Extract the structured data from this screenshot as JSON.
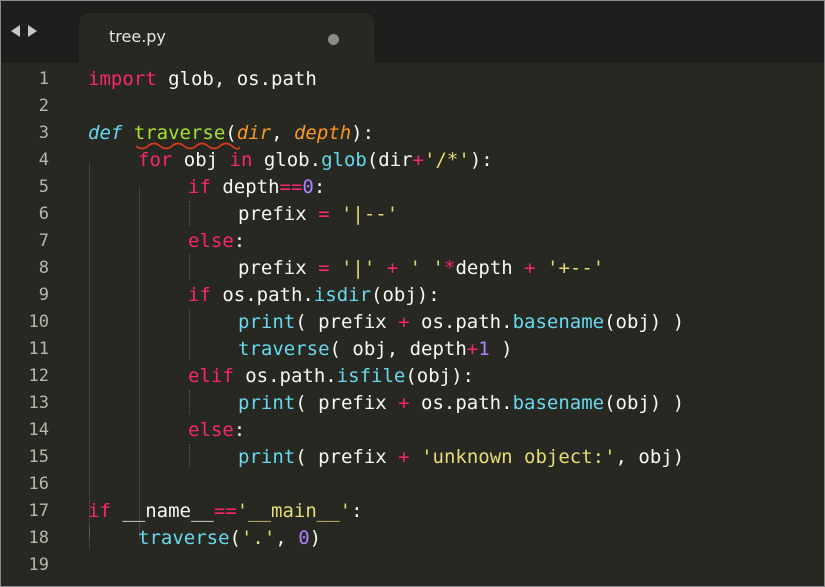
{
  "tab": {
    "title": "tree.py"
  },
  "line_numbers": [
    "1",
    "2",
    "3",
    "4",
    "5",
    "6",
    "7",
    "8",
    "9",
    "10",
    "11",
    "12",
    "13",
    "14",
    "15",
    "16",
    "17",
    "18",
    "19"
  ],
  "code": {
    "l1": {
      "import": "import",
      "rest": " glob, os.path"
    },
    "l3": {
      "def": "def",
      "sp": " ",
      "name": "traverse",
      "open": "(",
      "p1": "dir",
      "comma": ", ",
      "p2": "depth",
      "close": "):"
    },
    "l4": {
      "for": "for",
      "a": " obj ",
      "in": "in",
      "b": " glob.",
      "glob": "glob",
      "c": "(dir",
      "plus": "+",
      "s": "'/*'",
      "d": "):"
    },
    "l5": {
      "if": "if",
      "a": " depth",
      "eq": "==",
      "zero": "0",
      "b": ":"
    },
    "l6": {
      "a": "prefix ",
      "eq": "=",
      "sp": " ",
      "s": "'|--'"
    },
    "l7": {
      "else": "else",
      "b": ":"
    },
    "l8": {
      "a": "prefix ",
      "eq": "=",
      "sp": " ",
      "s1": "'|'",
      "sp2": " ",
      "p1": "+",
      "sp3": " ",
      "s2": "' '",
      "mul": "*",
      "b": "depth ",
      "p2": "+",
      "sp4": " ",
      "s3": "'+--'"
    },
    "l9": {
      "if": "if",
      "a": " os.path.",
      "fn": "isdir",
      "b": "(obj):"
    },
    "l10": {
      "print": "print",
      "a": "( prefix ",
      "plus": "+",
      "b": " os.path.",
      "fn": "basename",
      "c": "(obj) )"
    },
    "l11": {
      "fn": "traverse",
      "a": "( obj, depth",
      "plus": "+",
      "one": "1",
      "b": " )"
    },
    "l12": {
      "elif": "elif",
      "a": " os.path.",
      "fn": "isfile",
      "b": "(obj):"
    },
    "l13": {
      "print": "print",
      "a": "( prefix ",
      "plus": "+",
      "b": " os.path.",
      "fn": "basename",
      "c": "(obj) )"
    },
    "l14": {
      "else": "else",
      "b": ":"
    },
    "l15": {
      "print": "print",
      "a": "( prefix ",
      "plus": "+",
      "sp": " ",
      "s": "'unknown object:'",
      "b": ", obj)"
    },
    "l17": {
      "if": "if",
      "a": " __name__",
      "eq": "==",
      "s": "'__main__'",
      "b": ":"
    },
    "l18": {
      "fn": "traverse",
      "a": "(",
      "s": "'.'",
      "b": ", ",
      "zero": "0",
      "c": ")"
    }
  }
}
